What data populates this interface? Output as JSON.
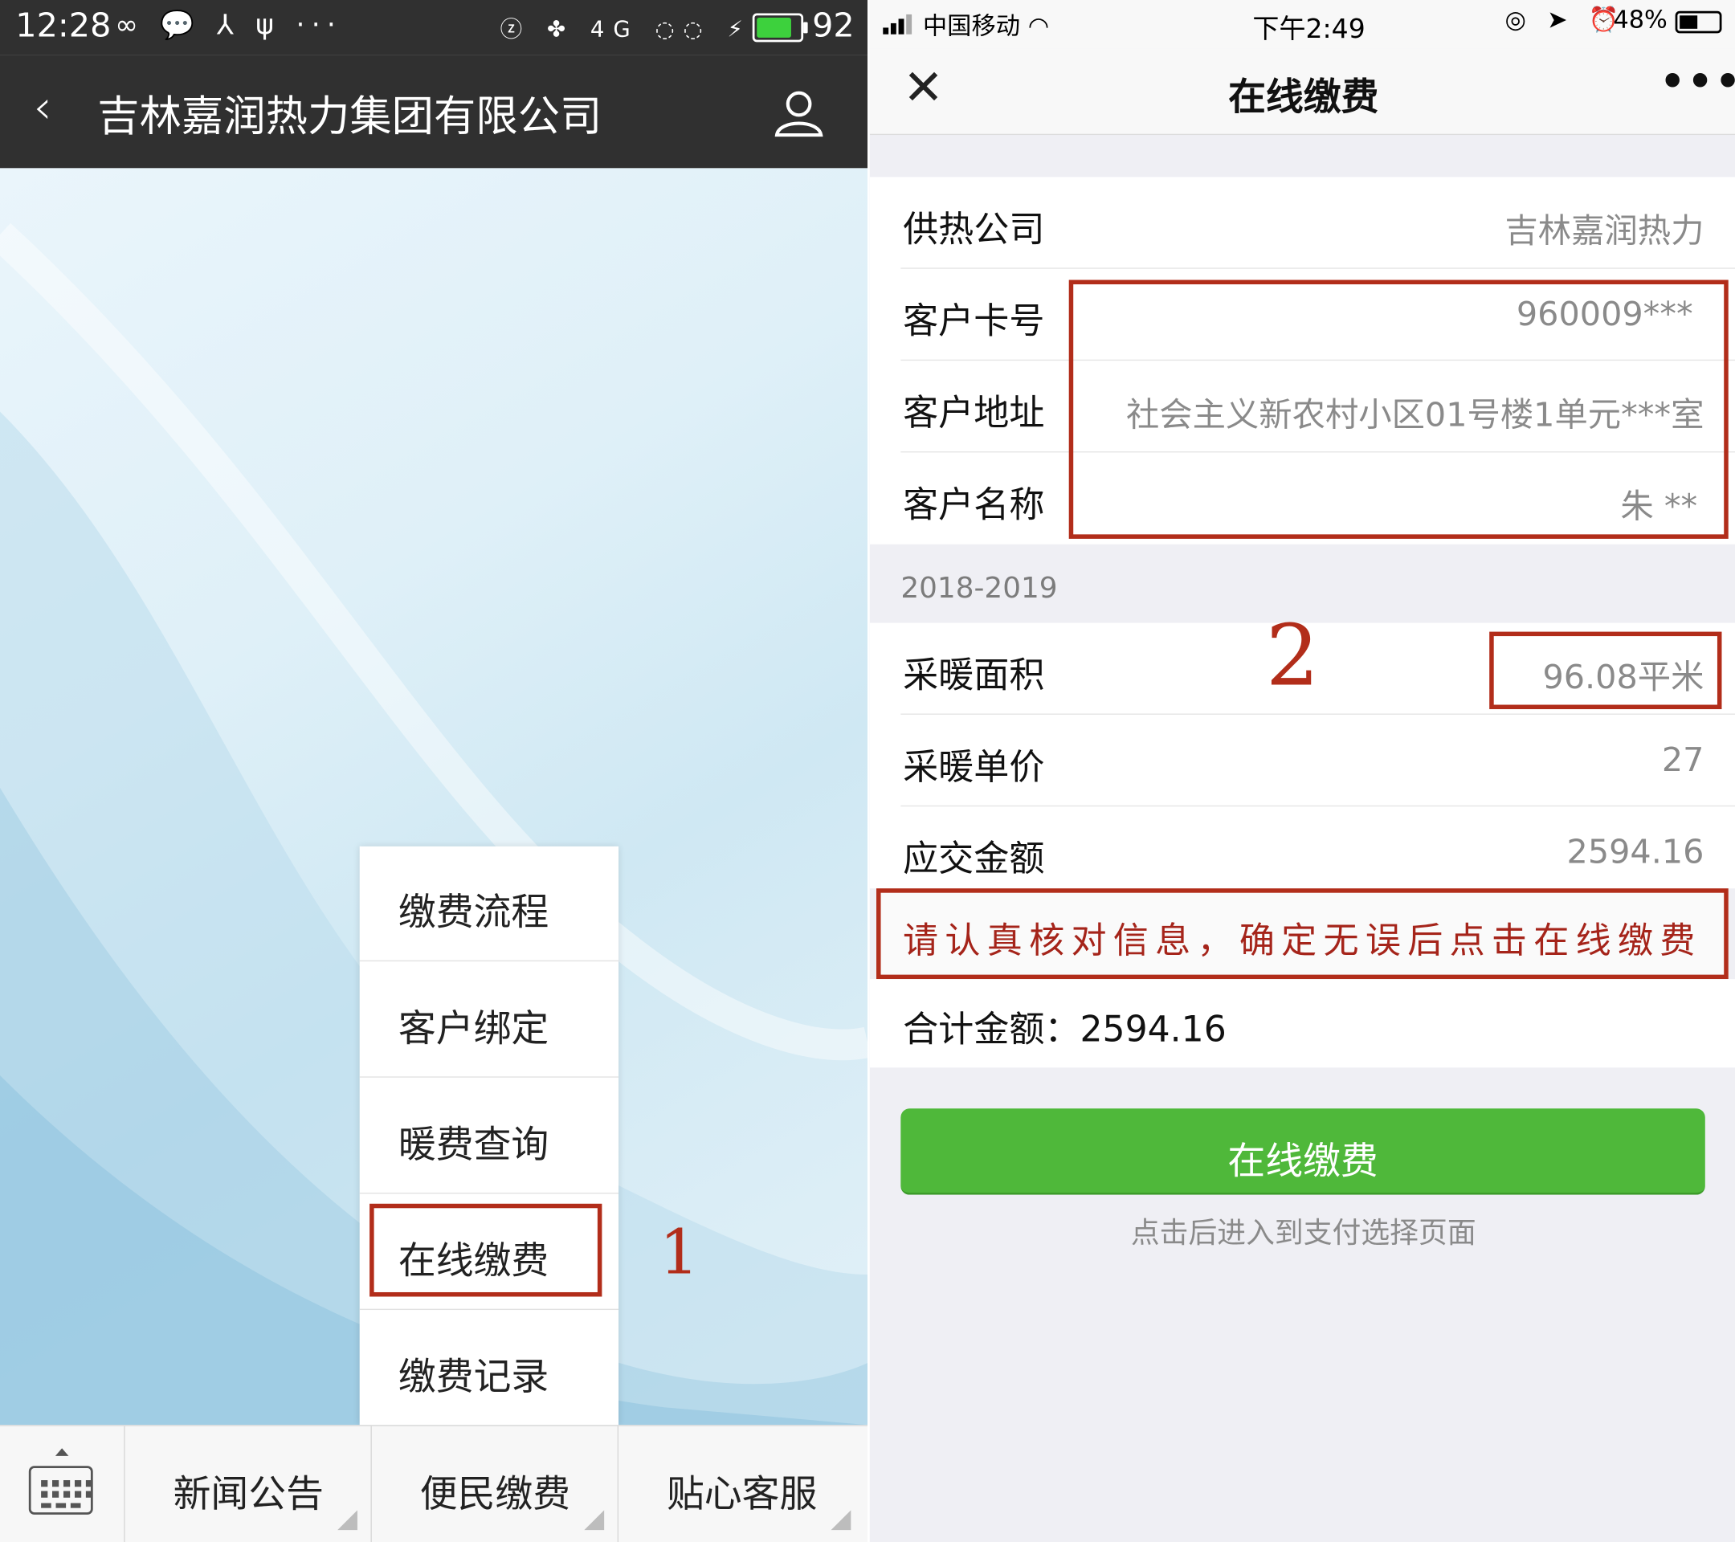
{
  "left": {
    "status_bar": {
      "time": "12:28",
      "icons": "∞ 💬 ⅄ ψ ···",
      "system_icons": "ⓩ ✤ 4G ◌◌ ⚡",
      "battery_level": 0.92,
      "battery_text": "92"
    },
    "nav": {
      "back": "‹",
      "title": "吉林嘉润热力集团有限公司"
    },
    "menu": {
      "items": [
        "缴费流程",
        "客户绑定",
        "暖费查询",
        "在线缴费",
        "缴费记录"
      ]
    },
    "annotation_number": "1",
    "bottom_tabs": [
      "新闻公告",
      "便民缴费",
      "贴心客服"
    ],
    "keyboard_dots": "▪▪▪▪▪\n▪▪▪▪▪\n▬▬▬"
  },
  "right": {
    "status_bar": {
      "carrier": "中国移动",
      "wifi": "◠",
      "time": "下午2:49",
      "icons": "◎ ➤ ⏰",
      "battery_text": "48%",
      "battery_level": 0.48
    },
    "nav": {
      "close": "✕",
      "title": "在线缴费",
      "more": "•••"
    },
    "rows": [
      {
        "label": "供热公司",
        "value": "吉林嘉润热力"
      },
      {
        "label": "客户卡号",
        "value": "960009***"
      },
      {
        "label": "客户地址",
        "value": "社会主义新农村小区01号楼1单元***室"
      },
      {
        "label": "客户名称",
        "value": "朱 **"
      }
    ],
    "season": "2018-2019",
    "heating_rows": [
      {
        "label": "采暖面积",
        "value": "96.08平米"
      },
      {
        "label": "采暖单价",
        "value": "27"
      },
      {
        "label": "应交金额",
        "value": "2594.16"
      }
    ],
    "annotation_number": "2",
    "notice": "请认真核对信息，确定无误后点击在线缴费",
    "total": "合计金额：2594.16",
    "pay_button": "在线缴费",
    "pay_hint": "点击后进入到支付选择页面",
    "accent_color": "#4fb83a",
    "annotation_color": "#b22d1a"
  }
}
